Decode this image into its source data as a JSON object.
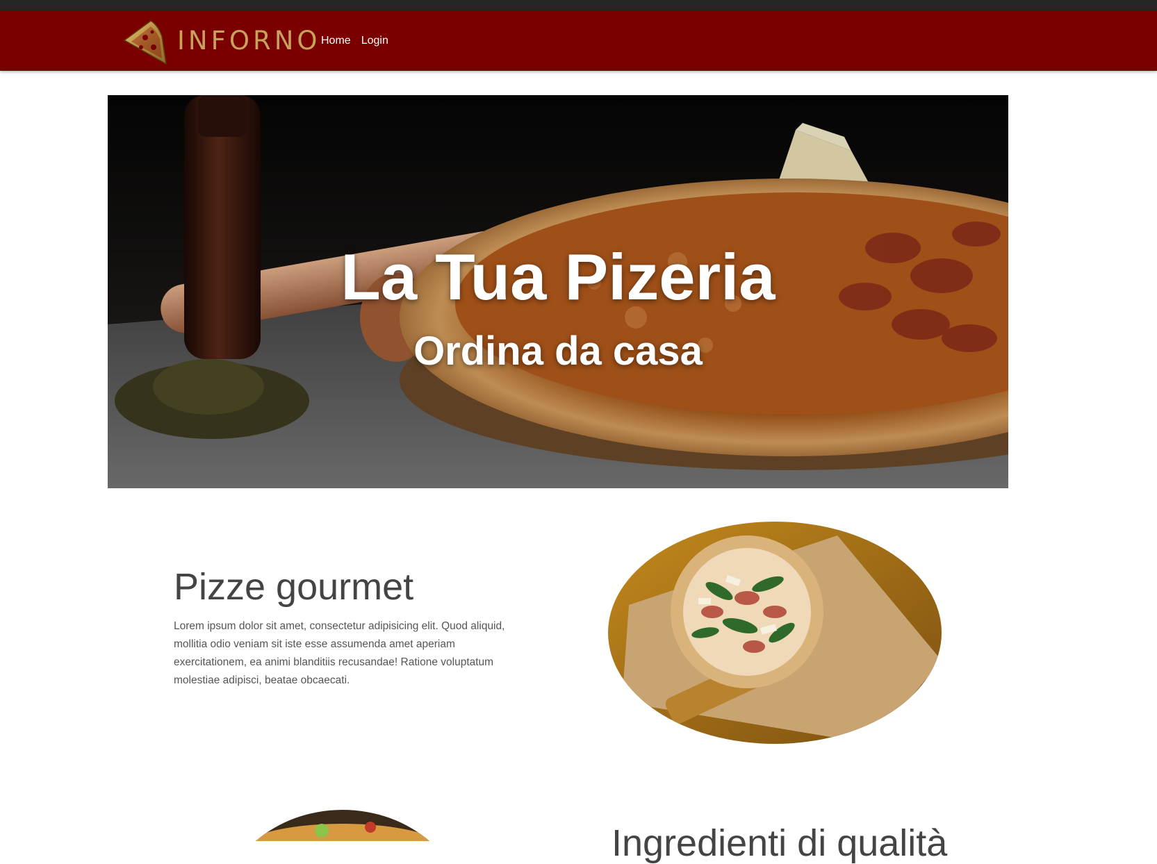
{
  "brand": {
    "name": "INFORNO"
  },
  "nav": {
    "links": [
      {
        "label": "Home"
      },
      {
        "label": "Login"
      }
    ]
  },
  "hero": {
    "title": "La Tua Pizeria",
    "subtitle": "Ordina da casa"
  },
  "features": [
    {
      "title": "Pizze gourmet",
      "text": "Lorem ipsum dolor sit amet, consectetur adipisicing elit. Quod aliquid, mollitia odio veniam sit iste esse assumenda amet aperiam exercitationem, ea animi blanditiis recusandae! Ratione voluptatum molestiae adipisci, beatae obcaecati."
    },
    {
      "title": "Ingredienti di qualità"
    }
  ],
  "colors": {
    "navbar": "#7a0000",
    "topstrip": "#262626",
    "brand_gold": "#c8a15a",
    "heading": "#444444",
    "body_text": "#555555"
  },
  "icons": {
    "logo": "pizza-slice-icon"
  }
}
